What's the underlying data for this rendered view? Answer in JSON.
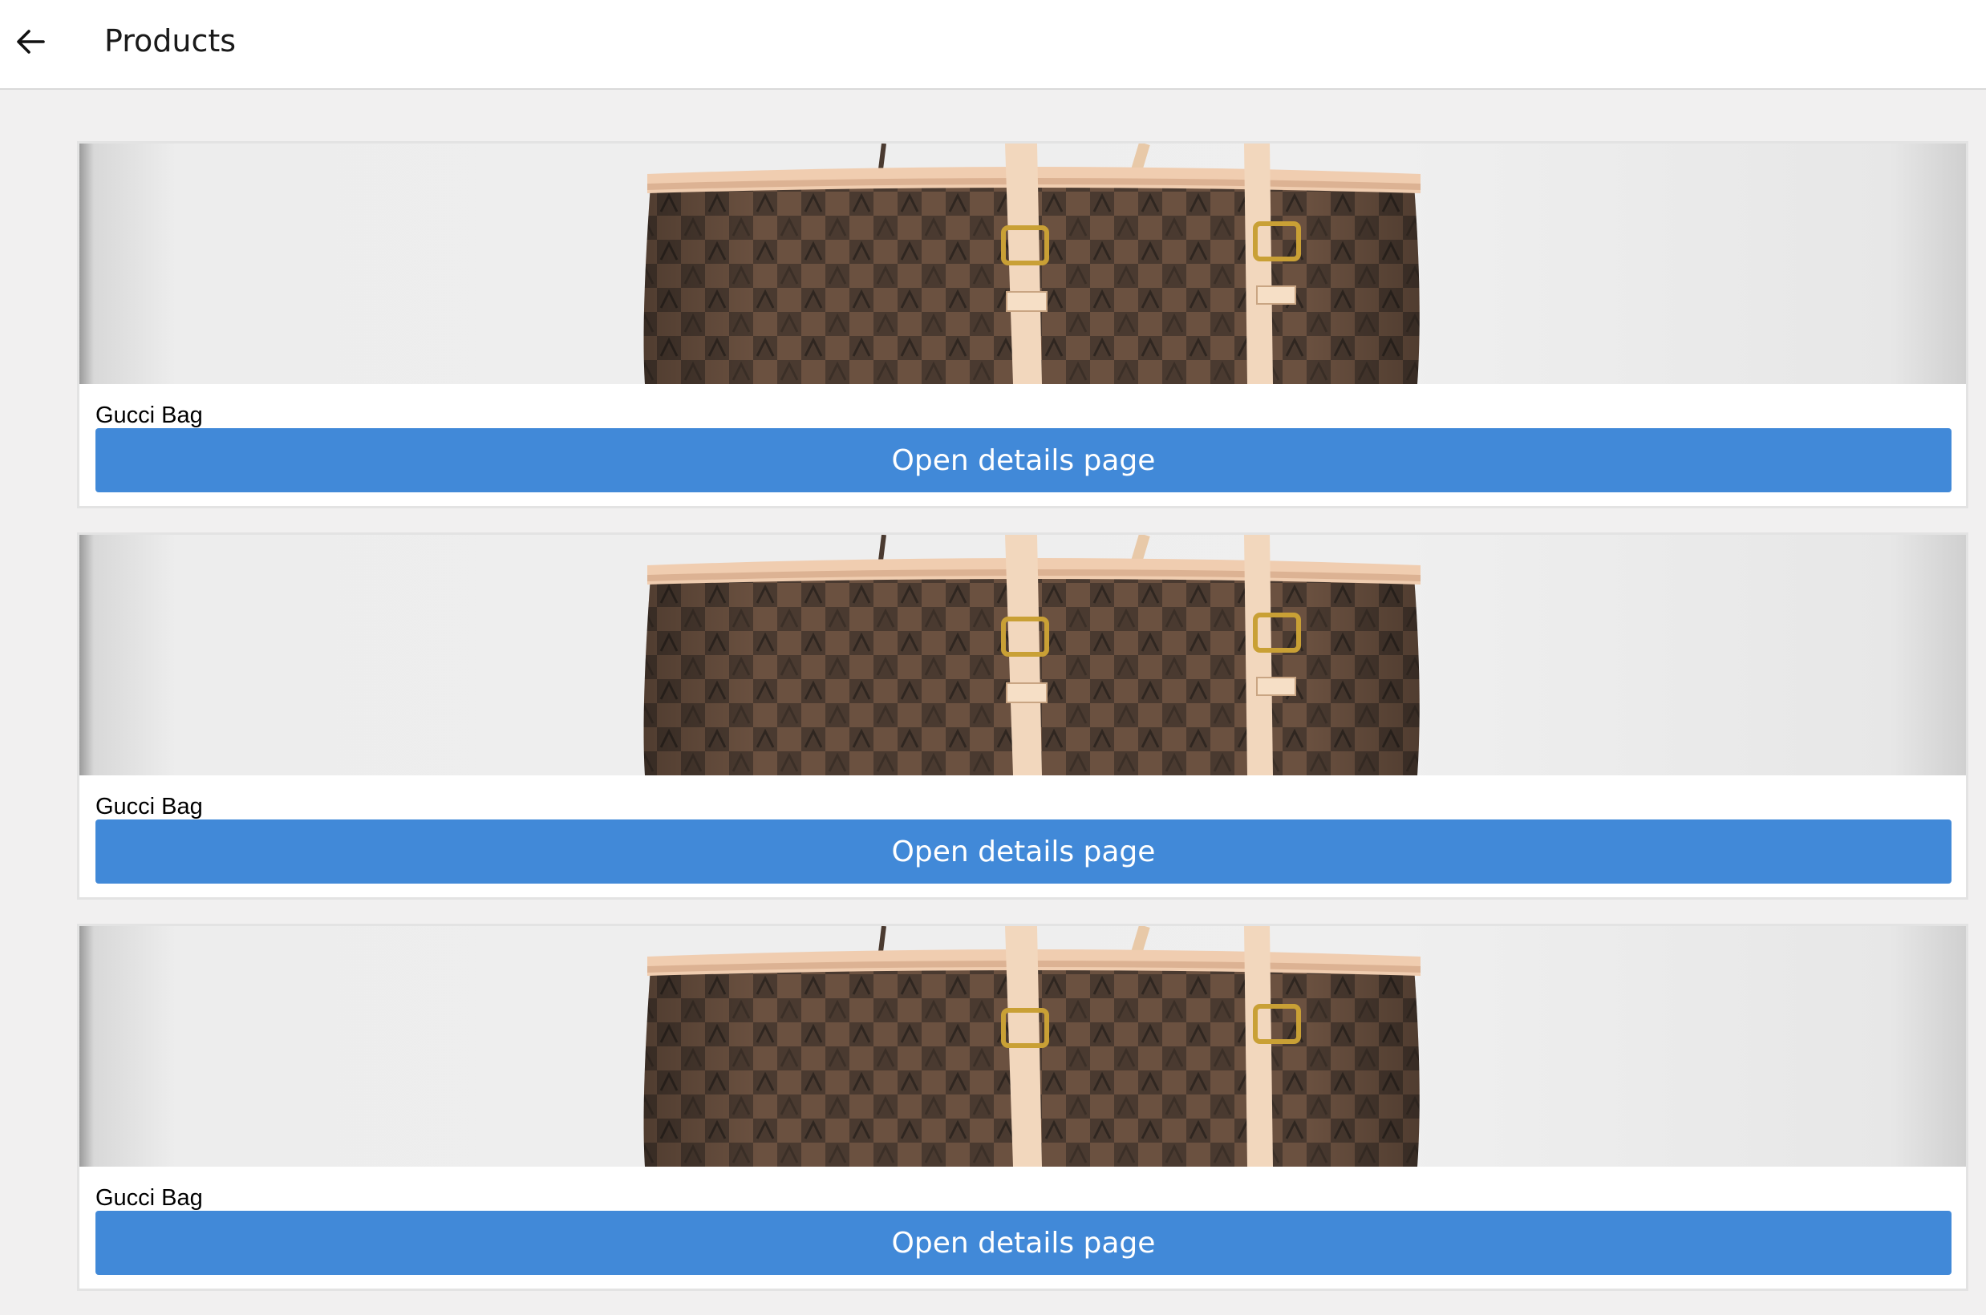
{
  "header": {
    "title": "Products",
    "back_icon": "arrow-left-icon"
  },
  "colors": {
    "appbar_bg": "#ffffff",
    "page_bg": "#f1f0f0",
    "button_bg": "#4189d8",
    "button_text": "#ffffff"
  },
  "products": [
    {
      "name": "Gucci Bag",
      "button_label": "Open details page",
      "image_icon": "bag-image"
    },
    {
      "name": "Gucci Bag",
      "button_label": "Open details page",
      "image_icon": "bag-image"
    },
    {
      "name": "Gucci Bag",
      "button_label": "Open details page",
      "image_icon": "bag-image"
    }
  ]
}
